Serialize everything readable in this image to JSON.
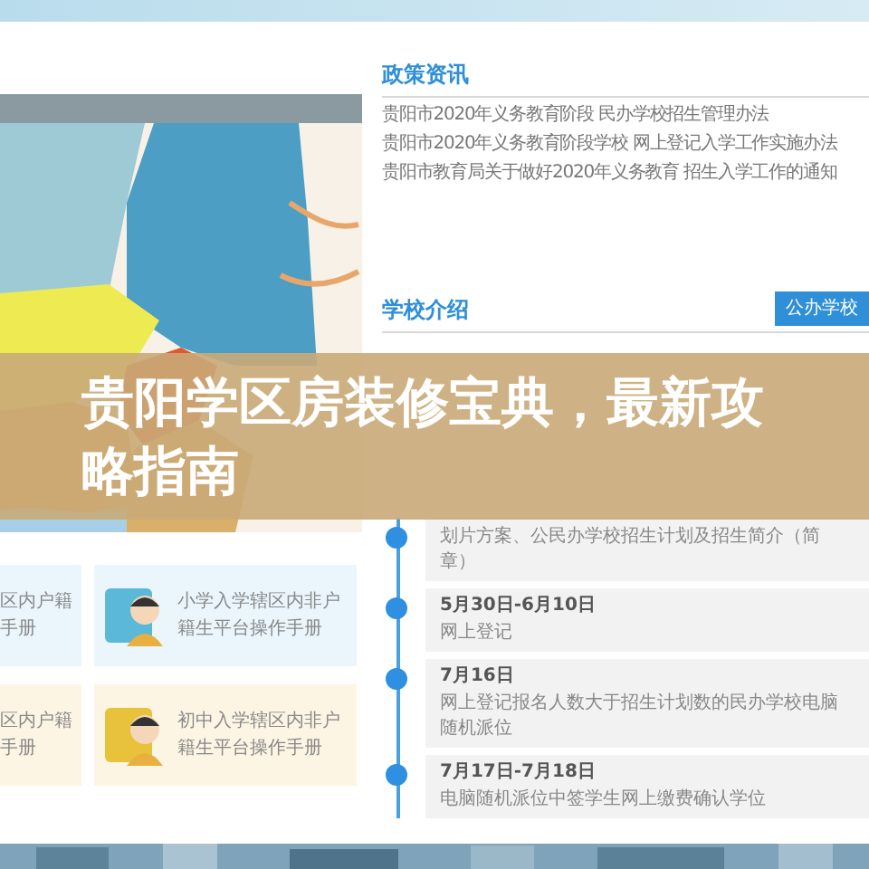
{
  "policy": {
    "title": "政策资讯",
    "items": [
      "贵阳市2020年义务教育阶段 民办学校招生管理办法",
      "贵阳市2020年义务教育阶段学校 网上登记入学工作实施办法",
      "贵阳市教育局关于做好2020年义务教育 招生入学工作的通知"
    ]
  },
  "school_intro": {
    "title": "学校介绍",
    "button": "公办学校"
  },
  "timeline": [
    {
      "detail": "划片方案、公民办学校招生计划及招生简介（简章）"
    },
    {
      "date": "5月30日-6月10日",
      "detail": "网上登记"
    },
    {
      "date": "7月16日",
      "detail": "网上登记报名人数大于招生计划数的民办学校电脑随机派位"
    },
    {
      "date": "7月17日-7月18日",
      "detail": "电脑随机派位中签学生网上缴费确认学位"
    }
  ],
  "cards": [
    {
      "kind": "primary",
      "left": [
        "区内户籍",
        "手册"
      ],
      "right": "小学入学辖区内非户籍生平台操作手册"
    },
    {
      "kind": "junior",
      "left": [
        "区内户籍",
        "手册"
      ],
      "right": "初中入学辖区内非户籍生平台操作手册"
    }
  ],
  "banner": {
    "title": "贵阳学区房装修宝典，最新攻略指南"
  }
}
